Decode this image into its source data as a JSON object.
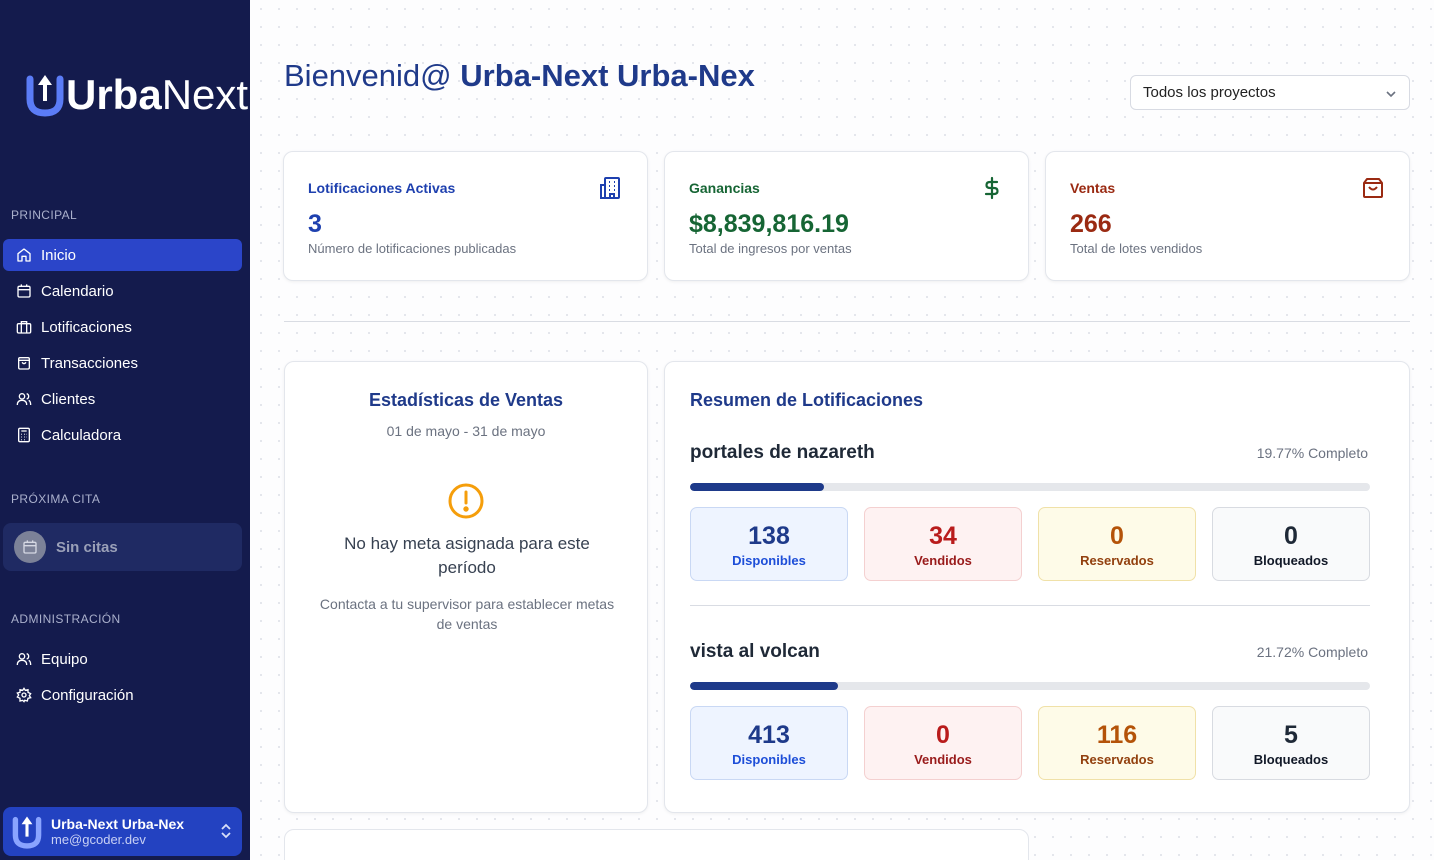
{
  "brand": {
    "name_bold": "Urba",
    "name_light": "Next"
  },
  "sidebar": {
    "principal_label": "PRINCIPAL",
    "items": [
      {
        "label": "Inicio",
        "icon": "home-icon",
        "active": true
      },
      {
        "label": "Calendario",
        "icon": "calendar-icon"
      },
      {
        "label": "Lotificaciones",
        "icon": "building-icon"
      },
      {
        "label": "Transacciones",
        "icon": "shopping-bag-icon"
      },
      {
        "label": "Clientes",
        "icon": "users-icon"
      },
      {
        "label": "Calculadora",
        "icon": "calculator-icon"
      }
    ],
    "proxima_cita_label": "PRÓXIMA CITA",
    "cita_text": "Sin citas",
    "admin_label": "ADMINISTRACIÓN",
    "admin_items": [
      {
        "label": "Equipo",
        "icon": "users-icon"
      },
      {
        "label": "Configuración",
        "icon": "gear-icon"
      }
    ],
    "user": {
      "name": "Urba-Next Urba-Nex",
      "email": "me@gcoder.dev"
    }
  },
  "header": {
    "greeting": "Bienvenid@ ",
    "user_name": "Urba-Next Urba-Nex",
    "project_select": "Todos los proyectos"
  },
  "stats": [
    {
      "title": "Lotificaciones Activas",
      "value": "3",
      "sub": "Número de lotificaciones publicadas",
      "color": "#1e40af",
      "icon": "building-icon"
    },
    {
      "title": "Ganancias",
      "value": "$8,839,816.19",
      "sub": "Total de ingresos por ventas",
      "color": "#166534",
      "icon": "dollar-icon"
    },
    {
      "title": "Ventas",
      "value": "266",
      "sub": "Total de lotes vendidos",
      "color": "#9a2a12",
      "icon": "shopping-bag-icon"
    }
  ],
  "sales_stats": {
    "title": "Estadísticas de Ventas",
    "date_range": "01 de mayo - 31 de mayo",
    "no_meta": "No hay meta asignada para este período",
    "contact": "Contacta a tu supervisor para establecer metas de ventas"
  },
  "summary": {
    "title": "Resumen de Lotificaciones",
    "projects": [
      {
        "name": "portales de nazareth",
        "pct_label": "19.77% Completo",
        "progress": 0.1977,
        "disponibles": "138",
        "vendidos": "34",
        "reservados": "0",
        "bloqueados": "0"
      },
      {
        "name": "vista al volcan",
        "pct_label": "21.72% Completo",
        "progress": 0.2172,
        "disponibles": "413",
        "vendidos": "0",
        "reservados": "116",
        "bloqueados": "5"
      }
    ],
    "labels": {
      "disponibles": "Disponibles",
      "vendidos": "Vendidos",
      "reservados": "Reservados",
      "bloqueados": "Bloqueados"
    }
  }
}
